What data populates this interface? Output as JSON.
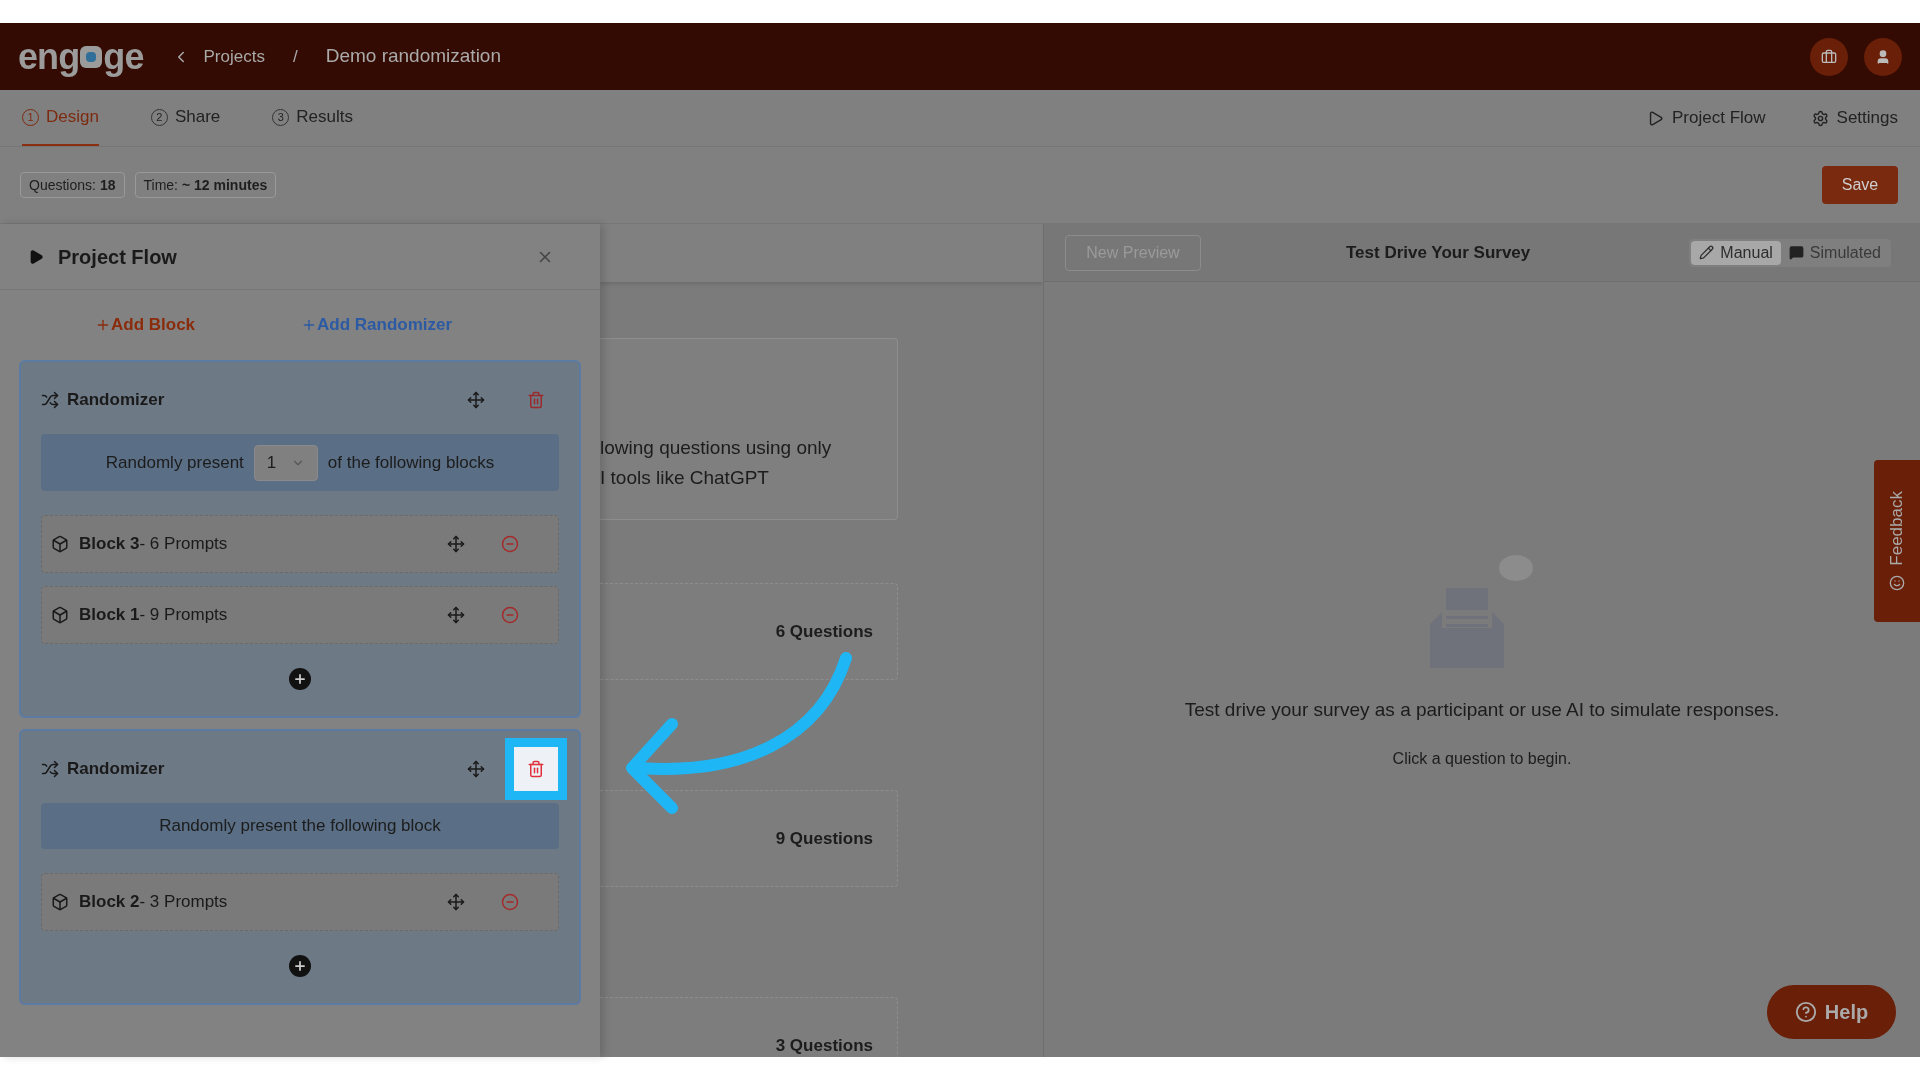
{
  "header": {
    "logo_left": "eng",
    "logo_right": "ge",
    "breadcrumbs": [
      {
        "label": "Projects"
      },
      {
        "label": "Demo randomization"
      }
    ],
    "separator": "/"
  },
  "tabs": [
    {
      "number": "1",
      "label": "Design",
      "selected": true
    },
    {
      "number": "2",
      "label": "Share",
      "selected": false
    },
    {
      "number": "3",
      "label": "Results",
      "selected": false
    }
  ],
  "top_actions": [
    {
      "kind": "play",
      "label": "Project Flow"
    },
    {
      "kind": "gear",
      "label": "Settings"
    }
  ],
  "stats": [
    {
      "label": "Questions:",
      "value": "18"
    },
    {
      "label": "Time:",
      "value": "~ 12 minutes"
    }
  ],
  "save_button": "Save",
  "project_flow": {
    "title": "Project Flow",
    "add_block": "Add Block",
    "add_randomizer": "Add Randomizer",
    "randomizers": [
      {
        "title": "Randomizer",
        "highlighted": false,
        "present": {
          "kind": "select",
          "before": "Randomly present",
          "value": "1",
          "after": "of the following blocks"
        },
        "blocks": [
          {
            "name": "Block 3",
            "detail": "- 6 Prompts"
          },
          {
            "name": "Block 1",
            "detail": "- 9 Prompts"
          }
        ]
      },
      {
        "title": "Randomizer",
        "highlighted": true,
        "present": {
          "kind": "text",
          "text": "Randomly present the following block"
        },
        "blocks": [
          {
            "name": "Block 2",
            "detail": "- 3 Prompts"
          }
        ]
      }
    ]
  },
  "survey_cards": [
    {
      "kind": "text",
      "lines": [
        "lowing questions using only",
        "I tools like ChatGPT"
      ]
    },
    {
      "kind": "count",
      "text": "6 Questions"
    },
    {
      "kind": "count",
      "text": "9 Questions"
    },
    {
      "kind": "count",
      "text": "3 Questions"
    }
  ],
  "preview": {
    "new_preview": "New Preview",
    "title": "Test Drive Your Survey",
    "modes": [
      {
        "kind": "pencil",
        "label": "Manual",
        "selected": true
      },
      {
        "kind": "chat",
        "label": "Simulated",
        "selected": false
      }
    ],
    "message": "Test drive your survey as a participant or use AI to simulate responses.",
    "hint": "Click a question to begin."
  },
  "feedback": "Feedback",
  "help": "Help"
}
